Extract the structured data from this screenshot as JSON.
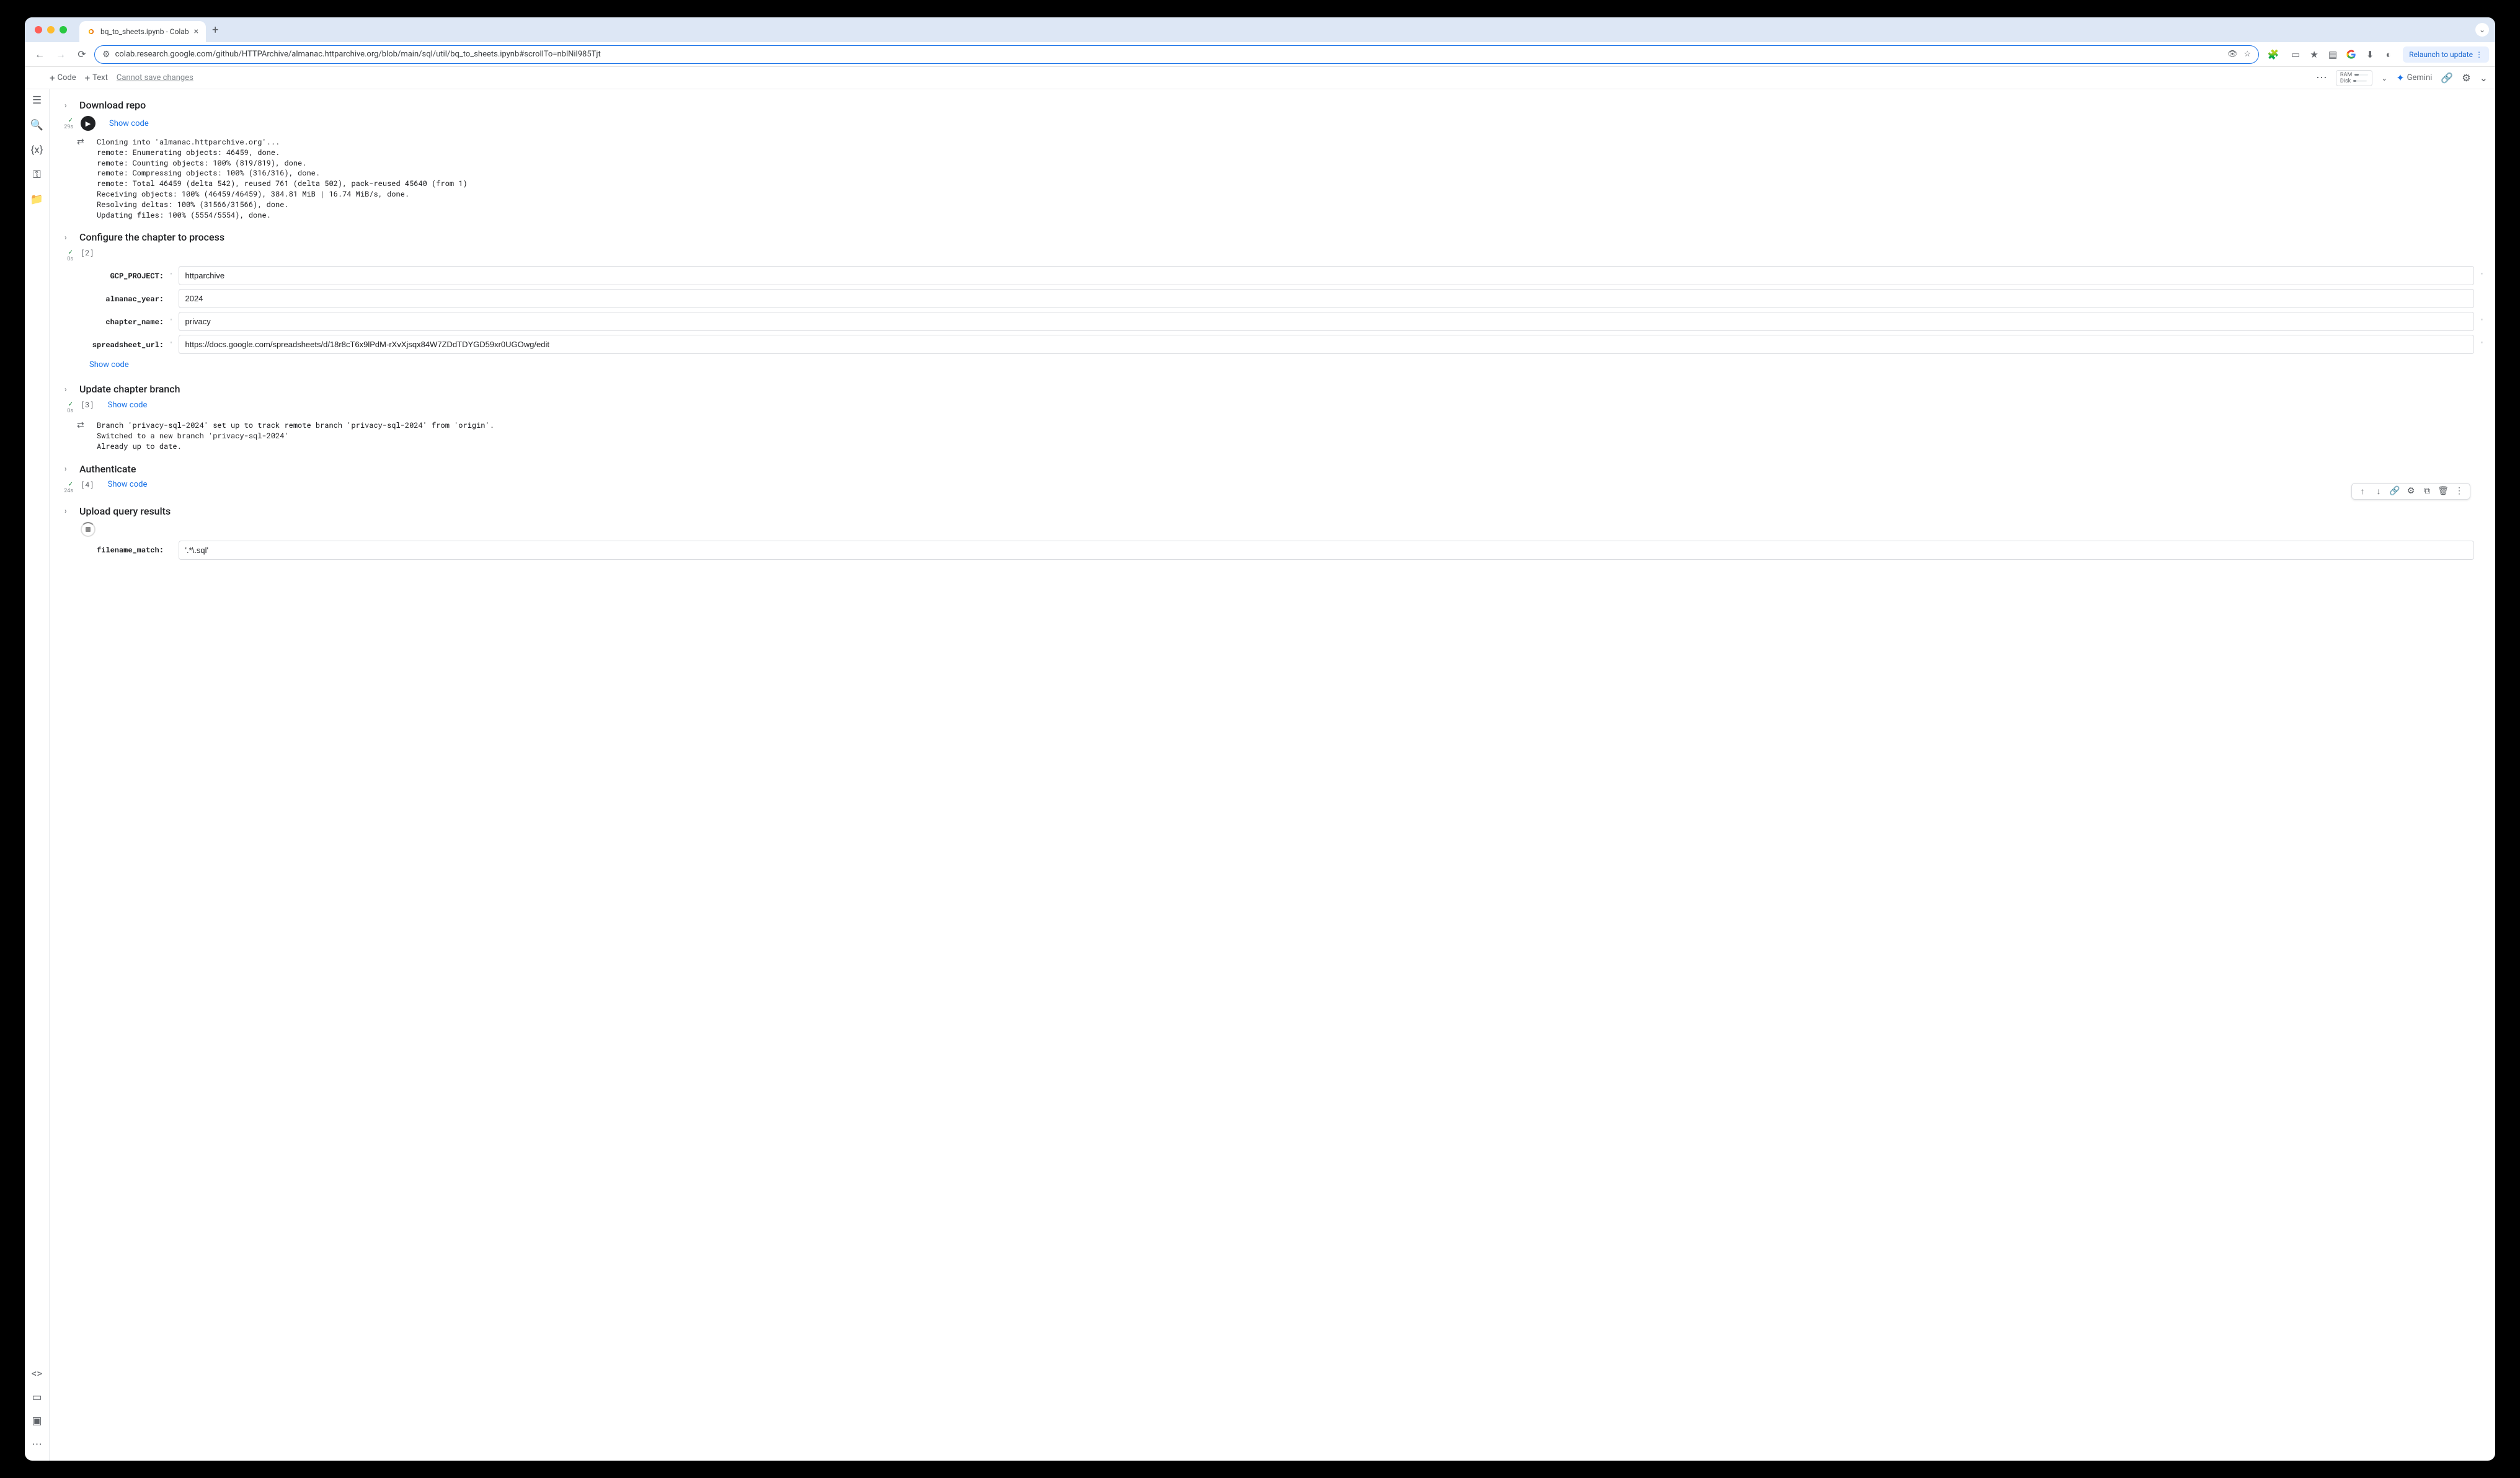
{
  "tab": {
    "title": "bq_to_sheets.ipynb - Colab"
  },
  "url": "colab.research.google.com/github/HTTPArchive/almanac.httparchive.org/blob/main/sql/util/bq_to_sheets.ipynb#scrollTo=nblNil985Tjt",
  "relaunch": "Relaunch to update",
  "colab_toolbar": {
    "code": "Code",
    "text": "Text",
    "cannot_save": "Cannot save changes",
    "ram": "RAM",
    "disk": "Disk",
    "gemini": "Gemini"
  },
  "sections": {
    "download": {
      "title": "Download repo",
      "gutter_time": "29s",
      "show_code": "Show code",
      "output": "Cloning into 'almanac.httparchive.org'...\nremote: Enumerating objects: 46459, done.\nremote: Counting objects: 100% (819/819), done.\nremote: Compressing objects: 100% (316/316), done.\nremote: Total 46459 (delta 542), reused 761 (delta 502), pack-reused 45640 (from 1)\nReceiving objects: 100% (46459/46459), 384.81 MiB | 16.74 MiB/s, done.\nResolving deltas: 100% (31566/31566), done.\nUpdating files: 100% (5554/5554), done."
    },
    "configure": {
      "title": "Configure the chapter to process",
      "exec_num": "[2]",
      "gutter_time": "0s",
      "fields": [
        {
          "label": "GCP_PROJECT:",
          "value": "httparchive"
        },
        {
          "label": "almanac_year:",
          "value": "2024"
        },
        {
          "label": "chapter_name:",
          "value": "privacy"
        },
        {
          "label": "spreadsheet_url:",
          "value": "https://docs.google.com/spreadsheets/d/18r8cT6x9lPdM-rXvXjsqx84W7ZDdTDYGD59xr0UGOwg/edit"
        }
      ],
      "show_code": "Show code"
    },
    "update": {
      "title": "Update chapter branch",
      "exec_num": "[3]",
      "gutter_time": "0s",
      "show_code": "Show code",
      "output": "Branch 'privacy-sql-2024' set up to track remote branch 'privacy-sql-2024' from 'origin'.\nSwitched to a new branch 'privacy-sql-2024'\nAlready up to date."
    },
    "auth": {
      "title": "Authenticate",
      "exec_num": "[4]",
      "gutter_time": "24s",
      "show_code": "Show code"
    },
    "upload": {
      "title": "Upload query results",
      "fields": [
        {
          "label": "filename_match:",
          "value": "'.*\\.sql'"
        }
      ]
    }
  }
}
